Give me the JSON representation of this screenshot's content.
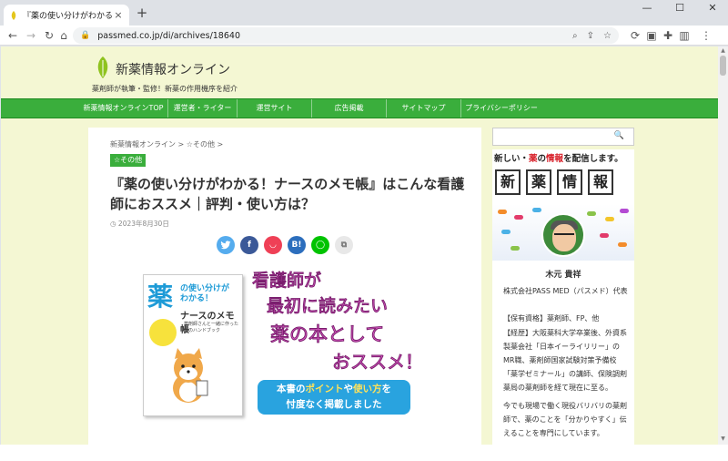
{
  "browser": {
    "tab_title": "『薬の使い分けがわかる！ナースのメモ帳』",
    "tab_close": "×",
    "new_tab": "+",
    "url": "passmed.co.jp/di/archives/18640",
    "window_controls": [
      "—",
      "☐",
      "✕"
    ]
  },
  "site": {
    "title": "新薬情報オンライン",
    "tagline": "薬剤師が執筆・監修！新薬の作用機序を紹介",
    "nav": [
      "新薬情報オンラインTOP",
      "運営者・ライター",
      "運営サイト",
      "広告掲載",
      "サイトマップ",
      "プライバシーポリシー"
    ]
  },
  "article": {
    "breadcrumb": "新薬情報オンライン > ☆その他 >",
    "category": "☆その他",
    "title": "『薬の使い分けがわかる！ナースのメモ帳』はこんな看護師におススメ｜評判・使い方は？",
    "date": "◷ 2023年8月30日",
    "share_buttons": [
      {
        "icon": "twitter-icon",
        "label": "🐦",
        "color": "#55acee"
      },
      {
        "icon": "facebook-icon",
        "label": "f",
        "color": "#3b5998"
      },
      {
        "icon": "pocket-icon",
        "label": "◡",
        "color": "#ef4056"
      },
      {
        "icon": "hatena-icon",
        "label": "B!",
        "color": "#2c6ebd"
      },
      {
        "icon": "line-icon",
        "label": "◯",
        "color": "#00c300"
      },
      {
        "icon": "copy-icon",
        "label": "⧉",
        "color": "#cccccc"
      }
    ]
  },
  "eyecatch": {
    "book_kanji": "薬",
    "book_title_1": "の使い分けが",
    "book_title_1b": "わかる！",
    "book_title_2": "ナースのメモ帳",
    "book_sub": "薬剤師さんと一緒に作った 薬のハンドブック",
    "lines": [
      "看護師が",
      "最初に読みたい",
      "薬の本として",
      "おススメ！"
    ],
    "box_line1_a": "本書の",
    "box_line1_b": "ポイント",
    "box_line1_c": "や",
    "box_line1_d": "使い方",
    "box_line1_e": "を",
    "box_line2": "忖度なく掲載しました"
  },
  "sidebar": {
    "banner_head_a": "新しい・",
    "banner_head_b": "薬",
    "banner_head_c": "の",
    "banner_head_d": "情報",
    "banner_head_e": "を配信します。",
    "banner_kanji": [
      "新",
      "薬",
      "情",
      "報"
    ],
    "profile_name": "木元 貴祥",
    "profile_lines": [
      "株式会社PASS MED（パスメド）代表",
      "【保有資格】薬剤師、FP、他",
      "【経歴】大阪薬科大学卒業後、外資系製薬会社「日本イーライリリー」のMR職、薬剤師国家試験対策予備校「薬学ゼミナール」の講師、保険調剤薬局の薬剤師を経て現在に至る。",
      "今でも現場で働く現役バリバリの薬剤師で、薬のことを「分かりやすく」伝えることを専門にしています。"
    ]
  },
  "colors": {
    "page_bg": "#f4f7d3",
    "nav_green": "#3aae3c",
    "accent_blue": "#29a3df"
  }
}
